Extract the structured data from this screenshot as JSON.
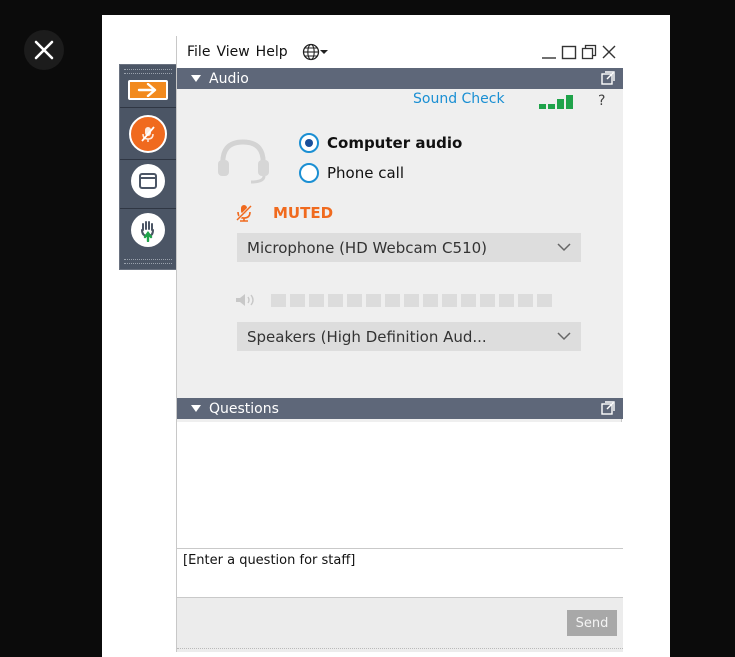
{
  "menu": {
    "file": "File",
    "view": "View",
    "help": "Help"
  },
  "audio": {
    "title": "Audio",
    "sound_check": "Sound Check",
    "help": "?",
    "options": {
      "computer": "Computer audio",
      "phone": "Phone call"
    },
    "selected": "computer",
    "status": "MUTED",
    "microphone": "Microphone (HD Webcam C510)",
    "speakers": "Speakers (High Definition Aud..."
  },
  "questions": {
    "title": "Questions",
    "placeholder": "[Enter a question for staff]",
    "send": "Send"
  },
  "colors": {
    "accent": "#1a8fd3",
    "muted": "#f06a1e",
    "header": "#5e6779",
    "toolbar": "#4b5565",
    "signal": "#1fa34a"
  },
  "icons": [
    "close-icon",
    "arrow-right-icon",
    "mic-muted-icon",
    "screen-icon",
    "raise-hand-icon",
    "globe-icon",
    "minimize-icon",
    "restore-icon",
    "pop-out-icon",
    "headset-icon",
    "speaker-icon",
    "chevron-down-icon"
  ]
}
